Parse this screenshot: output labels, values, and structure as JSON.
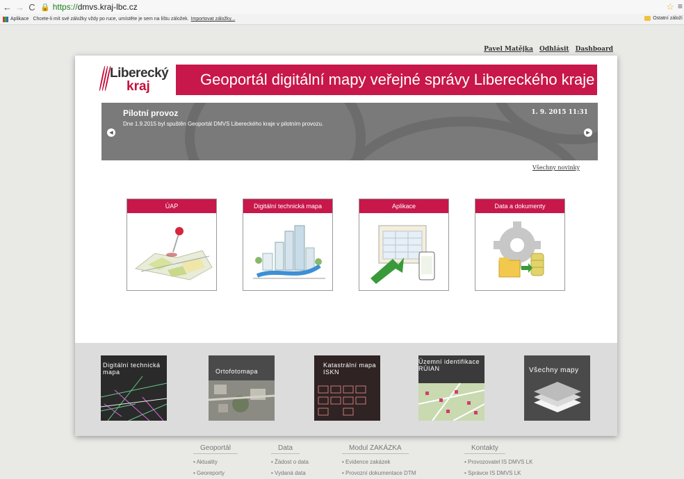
{
  "browser": {
    "url_protocol": "https://",
    "url_host": "dmvs.kraj-lbc.cz",
    "bookmarks_apps": "Aplikace",
    "bookmarks_hint": "Chcete-li mít své záložky vždy po ruce, umístěte je sem na lištu záložek.",
    "bookmarks_import": "Importovat záložky...",
    "other_bookmarks": "Ostatní záloží"
  },
  "userbar": {
    "user": "Pavel Matějka",
    "logout": "Odhlásit",
    "dashboard": "Dashboard"
  },
  "logo": {
    "line1": "Liberecký",
    "line2": "kraj"
  },
  "banner": {
    "title": "Geoportál digitální mapy veřejné správy Libereckého kraje"
  },
  "news": {
    "title": "Pilotní provoz",
    "text": "Dne 1.9.2015 byl spuštěn Geoportál DMVS Libereckého kraje v pilotním provozu.",
    "date": "1. 9. 2015 11:31",
    "all_link": "Všechny novinky"
  },
  "tiles": [
    {
      "label": "ÚAP",
      "icon": "map-pin-icon"
    },
    {
      "label": "Digitální technická mapa",
      "icon": "city-icon"
    },
    {
      "label": "Aplikace",
      "icon": "application-icon"
    },
    {
      "label": "Data a dokumenty",
      "icon": "gear-documents-icon"
    }
  ],
  "maps": [
    {
      "label": "Digitální technická mapa"
    },
    {
      "label": "Ortofotomapa"
    },
    {
      "label": "Katastrální mapa ISKN"
    },
    {
      "label": "Územní identifikace RÚIAN"
    },
    {
      "label": "Všechny mapy"
    }
  ],
  "footer": {
    "geoportal": {
      "title": "Geoportál",
      "items": [
        "Aktuality",
        "Georeporty"
      ]
    },
    "data": {
      "title": "Data",
      "items": [
        "Žádost o data",
        "Vydaná data"
      ]
    },
    "zakazka": {
      "title": "Modul ZAKÁZKA",
      "items": [
        "Evidence zakázek",
        "Provozní dokumentace DTM"
      ]
    },
    "kontakty": {
      "title": "Kontakty",
      "items": [
        "Provozovatel IS DMVS LK",
        "Správce IS DMVS LK"
      ]
    }
  },
  "colors": {
    "accent": "#c8174a",
    "news_bg": "#7a7a7a",
    "maps_bg": "#dcdcdc"
  }
}
